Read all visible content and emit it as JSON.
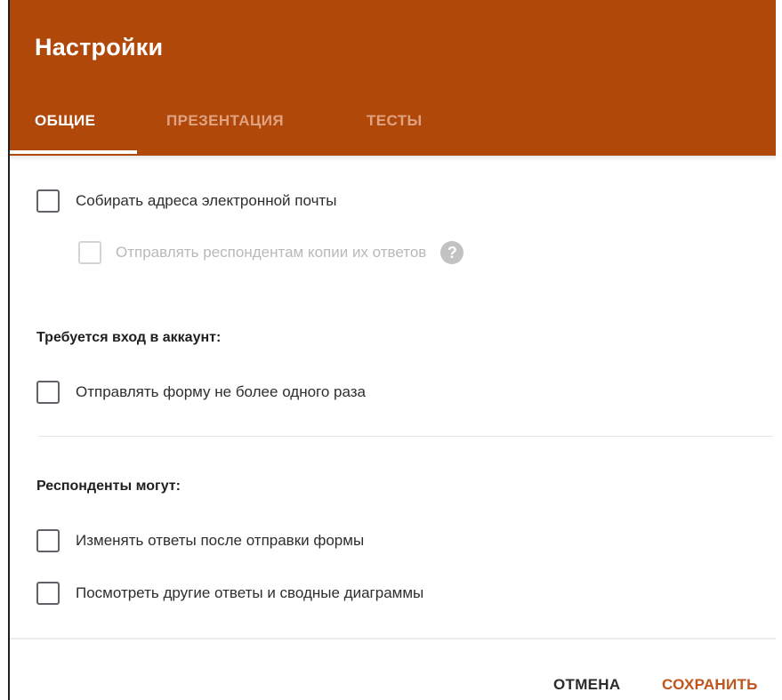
{
  "header": {
    "title": "Настройки",
    "tabs": [
      {
        "label": "ОБЩИЕ",
        "active": true
      },
      {
        "label": "ПРЕЗЕНТАЦИЯ",
        "active": false
      },
      {
        "label": "ТЕСТЫ",
        "active": false
      }
    ]
  },
  "options": {
    "collect_emails": {
      "label": "Собирать адреса электронной почты",
      "checked": false
    },
    "send_copies": {
      "label": "Отправлять респондентам копии их ответов",
      "checked": false,
      "disabled": true,
      "help_icon": "help-circle-icon",
      "help_glyph": "?"
    }
  },
  "login_section": {
    "title": "Требуется вход в аккаунт:",
    "limit_one": {
      "label": "Отправлять форму не более одного раза",
      "checked": false
    }
  },
  "respondents_section": {
    "title": "Респонденты могут:",
    "edit_after": {
      "label": "Изменять ответы после отправки формы",
      "checked": false
    },
    "see_summary": {
      "label": "Посмотреть другие ответы и сводные диаграммы",
      "checked": false
    }
  },
  "footer": {
    "cancel_label": "ОТМЕНА",
    "save_label": "СОХРАНИТЬ"
  },
  "colors": {
    "header_bg": "#b0480a",
    "accent": "#c0541c",
    "tab_inactive": "#e0a281"
  }
}
